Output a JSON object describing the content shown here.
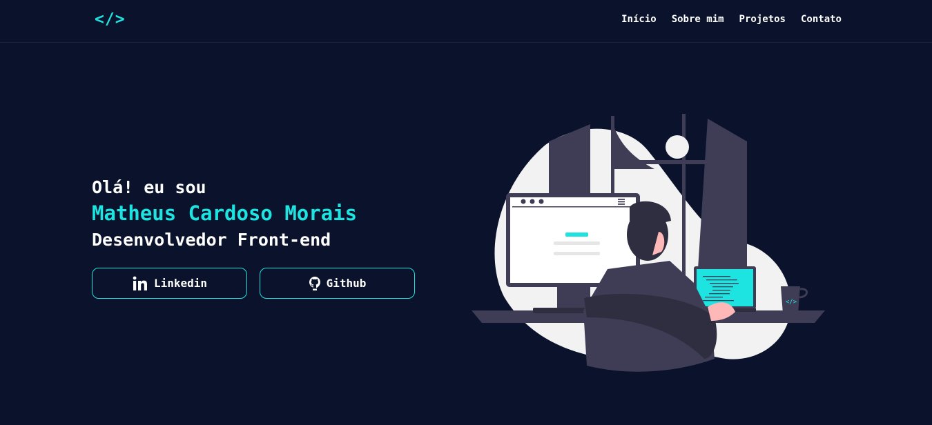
{
  "header": {
    "logo": "</>",
    "nav": [
      "Início",
      "Sobre mim",
      "Projetos",
      "Contato"
    ]
  },
  "hero": {
    "greeting": "Olá! eu sou",
    "name": "Matheus Cardoso Morais",
    "role": "Desenvolvedor Front-end",
    "buttons": {
      "linkedin": "Linkedin",
      "github": "Github"
    }
  },
  "illustration": {
    "mug_label": "</>"
  },
  "colors": {
    "background": "#0b122c",
    "accent": "#1de4e0",
    "text": "#ffffff",
    "illustration_dark": "#3f3d56",
    "illustration_light": "#f2f2f2"
  },
  "icons": [
    "linkedin-icon",
    "github-icon"
  ]
}
